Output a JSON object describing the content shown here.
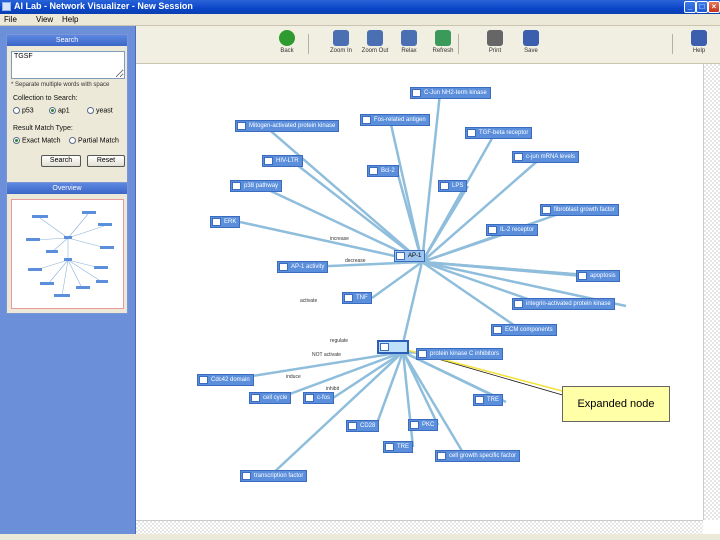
{
  "window": {
    "title": "AI Lab - Network Visualizer - New Session"
  },
  "menu": [
    "File",
    "View",
    "Help"
  ],
  "toolbar": {
    "buttons": [
      {
        "label": "Back",
        "icon": "back-arrow-icon",
        "color": "#2f9a2f"
      },
      {
        "label": "Zoom In",
        "icon": "zoom-in-icon",
        "color": "#4a6fb3"
      },
      {
        "label": "Zoom Out",
        "icon": "zoom-out-icon",
        "color": "#4a6fb3"
      },
      {
        "label": "Relax",
        "icon": "relax-icon",
        "color": "#4a6fb3"
      },
      {
        "label": "Refresh",
        "icon": "refresh-icon",
        "color": "#3a9a5a"
      },
      {
        "label": "Print",
        "icon": "print-icon",
        "color": "#666"
      },
      {
        "label": "Save",
        "icon": "save-icon",
        "color": "#3b5fae"
      },
      {
        "label": "Help",
        "icon": "help-icon",
        "color": "#3b5fae"
      }
    ]
  },
  "search": {
    "header": "Search",
    "input_value": "TGSF",
    "hint": "* Separate multiple words with space",
    "collection_label": "Collection to Search:",
    "collections": [
      {
        "label": "p53",
        "selected": false
      },
      {
        "label": "ap1",
        "selected": true
      },
      {
        "label": "yeast",
        "selected": false
      }
    ],
    "match_label": "Result Match Type:",
    "match_types": [
      {
        "label": "Exact Match",
        "selected": true
      },
      {
        "label": "Partial Match",
        "selected": false
      }
    ],
    "search_button": "Search",
    "reset_button": "Reset"
  },
  "overview": {
    "header": "Overview"
  },
  "graph": {
    "hub_label": "AP-1",
    "selected_label": "",
    "nodes": [
      "C-Jun NH2-term kinase",
      "Mitogen-activated protein kinase",
      "Fos-related antigen",
      "TGF-beta receptor",
      "c-jun mRNA levels",
      "HIV-LTR",
      "Bcl-2",
      "LPS",
      "p38 pathway",
      "fibroblast growth factor",
      "ERK",
      "IL-2 receptor",
      "AP-1 activity",
      "TNF",
      "apoptosis",
      "transcriptional cell phenotype",
      "PKC",
      "integrin-activated protein kinase",
      "transcriptional activity",
      "ECM components",
      "protein kinase C inhibitors",
      "Cdc42 domain",
      "cell cycle",
      "c-fos",
      "TRE",
      "DNA",
      "CD28",
      "PKC",
      "TRE",
      "cell growth specific factor",
      "transcription factor"
    ],
    "edge_labels": [
      "increase",
      "decrease",
      "activate",
      "NOT activate",
      "regulate",
      "induce",
      "inhibit"
    ],
    "callout": "Expanded node"
  }
}
